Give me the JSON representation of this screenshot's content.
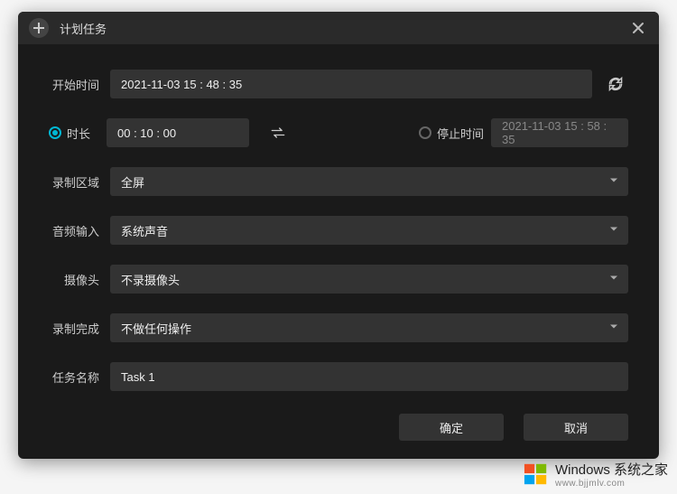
{
  "title": "计划任务",
  "fields": {
    "start_time": {
      "label": "开始时间",
      "value": "2021-11-03 15 : 48 : 35"
    },
    "duration": {
      "label": "时长",
      "value": "00 : 10 : 00"
    },
    "stop_time": {
      "label": "停止时间",
      "value": "2021-11-03 15 : 58 : 35"
    },
    "region": {
      "label": "录制区域",
      "value": "全屏"
    },
    "audio": {
      "label": "音频输入",
      "value": "系统声音"
    },
    "camera": {
      "label": "摄像头",
      "value": "不录摄像头"
    },
    "after": {
      "label": "录制完成",
      "value": "不做任何操作"
    },
    "task_name": {
      "label": "任务名称",
      "value": "Task 1"
    }
  },
  "radio": {
    "duration_selected": true,
    "stop_selected": false
  },
  "buttons": {
    "ok": "确定",
    "cancel": "取消"
  },
  "watermark": {
    "main": "Windows 系统之家",
    "sub": "www.bjjmlv.com"
  }
}
